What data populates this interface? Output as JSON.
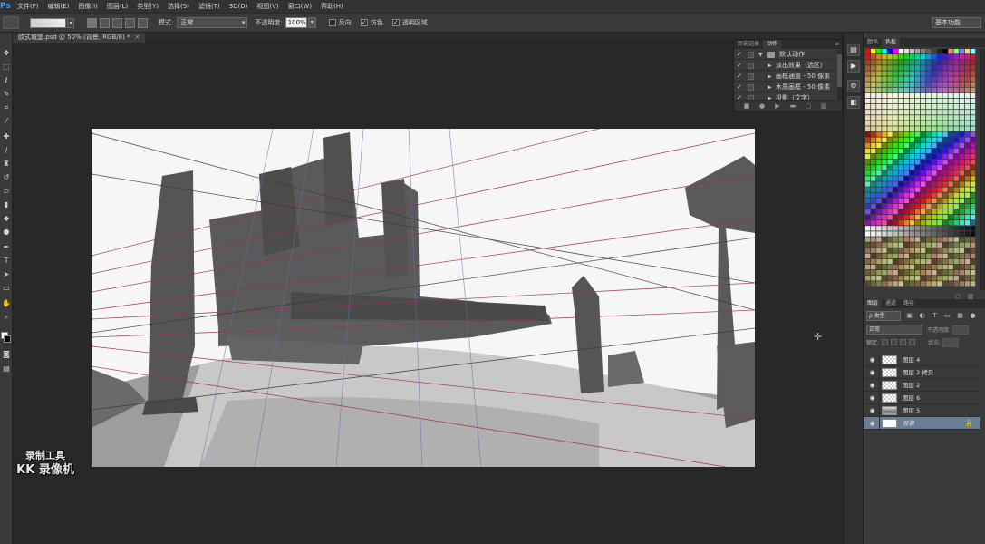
{
  "app": {
    "logo": "Ps",
    "menu": [
      "文件(F)",
      "编辑(E)",
      "图像(I)",
      "图层(L)",
      "类型(Y)",
      "选择(S)",
      "滤镜(T)",
      "3D(D)",
      "视图(V)",
      "窗口(W)",
      "帮助(H)"
    ]
  },
  "options": {
    "mode_label": "模式:",
    "mode_value": "正常",
    "opacity_label": "不透明度:",
    "opacity_value": "100%",
    "reverse_label": "反向",
    "dither_label": "仿色",
    "transparency_label": "透明区域",
    "workspace": "基本功能"
  },
  "document": {
    "tab_label": "欧式城堡.psd @ 50% (背景, RGB/8) *",
    "close": "×"
  },
  "actions_panel": {
    "tabs": [
      "历史记录",
      "动作"
    ],
    "active_tab": "动作",
    "menu": "≡",
    "items": [
      {
        "label": "默认动作",
        "kind": "set"
      },
      {
        "label": "淡出效果（选区）",
        "kind": "action"
      },
      {
        "label": "画框通道 - 50 像素",
        "kind": "action"
      },
      {
        "label": "木质画框 - 50 像素",
        "kind": "action"
      },
      {
        "label": "投影（文字）",
        "kind": "action"
      }
    ]
  },
  "swatches_panel": {
    "tabs": [
      "颜色",
      "色板"
    ],
    "active_tab": "色板"
  },
  "layers_panel": {
    "tabs": [
      "图层",
      "通道",
      "路径"
    ],
    "active_tab": "图层",
    "filter_label": "ρ 类型",
    "blend_mode": "正常",
    "opacity_label": "不透明度:",
    "lock_label": "锁定:",
    "fill_label": "填充:",
    "layers": [
      {
        "name": "图层 4",
        "thumb": "transparent",
        "selected": false
      },
      {
        "name": "图层 2 拷贝",
        "thumb": "transparent",
        "selected": false
      },
      {
        "name": "图层 2",
        "thumb": "transparent",
        "selected": false
      },
      {
        "name": "图层 6",
        "thumb": "transparent",
        "selected": false
      },
      {
        "name": "图层 5",
        "thumb": "sketch",
        "selected": false
      },
      {
        "name": "背景",
        "thumb": "solid",
        "selected": true,
        "locked": true
      }
    ]
  },
  "watermark": {
    "line1": "录制工具",
    "line2": "KK 录像机"
  },
  "colors": {
    "canvas_bg": "#f6f6f6",
    "workspace_bg": "#282828",
    "panel_bg": "#3a3a3a",
    "selected_layer": "#6b7d94",
    "perspective_red": "#9a3346",
    "perspective_blue": "#6a6ab8"
  }
}
